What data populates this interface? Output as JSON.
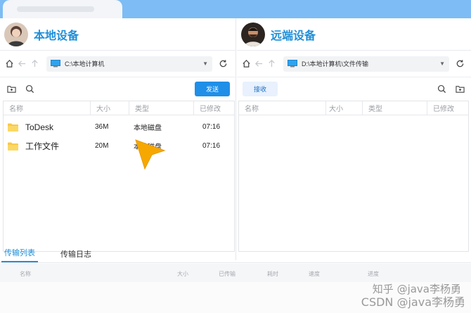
{
  "colors": {
    "accent": "#1f8fd8",
    "topbar": "#7dbcf4",
    "folder": "#f7c948",
    "cursor": "#f6a800"
  },
  "local": {
    "title": "本地设备",
    "path": "C:\\本地计算机",
    "send_label": "发送",
    "columns": [
      "名称",
      "大小",
      "类型",
      "已修改"
    ],
    "files": [
      {
        "name": "ToDesk",
        "size": "36M",
        "type": "本地磁盘",
        "modified": "07:16"
      },
      {
        "name": "工作文件",
        "size": "20M",
        "type": "本地磁盘",
        "modified": "07:16"
      }
    ]
  },
  "remote": {
    "title": "远端设备",
    "path": "D:\\本地计算机\\文件传输",
    "receive_label": "接收",
    "columns": [
      "名称",
      "大小",
      "类型",
      "已修改"
    ],
    "files": []
  },
  "bottom": {
    "tabs": [
      "传输列表",
      "传输日志"
    ],
    "columns": [
      "名称",
      "大小",
      "已传输",
      "耗时",
      "速度",
      "进度"
    ]
  },
  "watermarks": [
    "知乎 @java李杨勇",
    "CSDN @java李杨勇"
  ]
}
